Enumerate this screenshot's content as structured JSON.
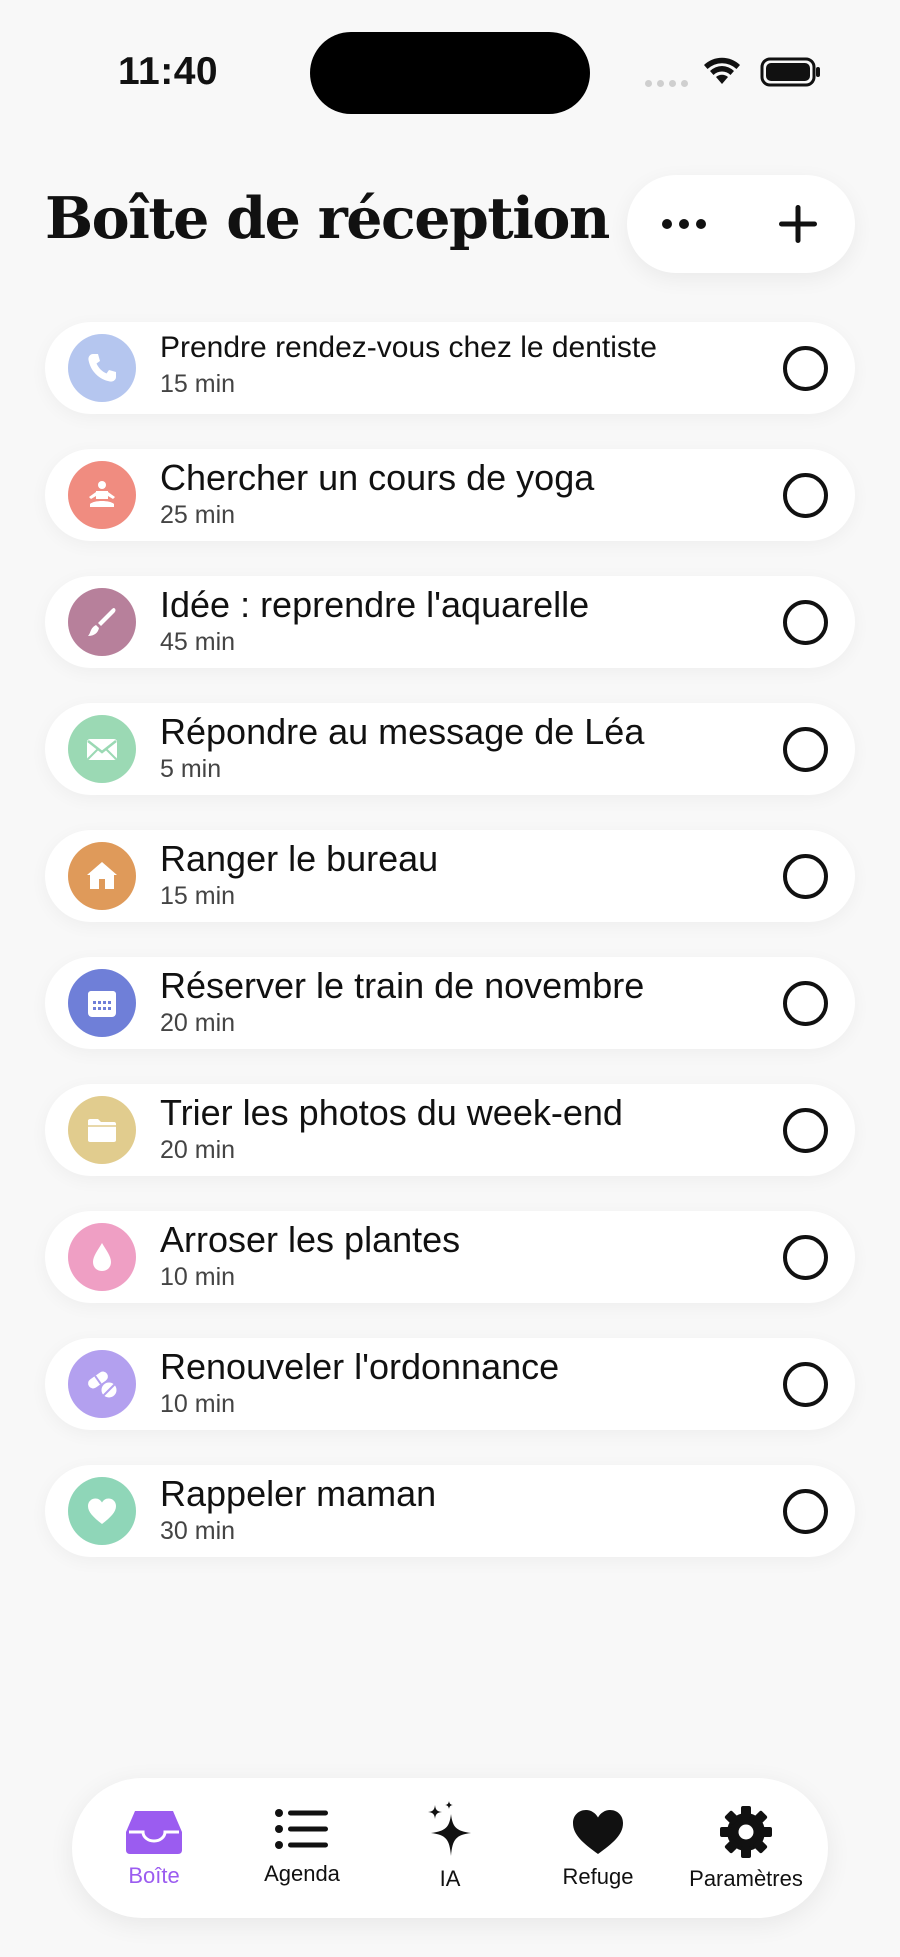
{
  "status_bar": {
    "time": "11:40"
  },
  "header": {
    "title": "Boîte de réception"
  },
  "tasks": [
    {
      "title": "Prendre rendez-vous chez le dentiste",
      "duration": "15 min",
      "icon": "phone-icon",
      "color": "#b5c6ef"
    },
    {
      "title": "Chercher un cours de yoga",
      "duration": "25 min",
      "icon": "meditation-icon",
      "color": "#f08c80"
    },
    {
      "title": "Idée : reprendre l'aquarelle",
      "duration": "45 min",
      "icon": "paintbrush-icon",
      "color": "#b7809b"
    },
    {
      "title": "Répondre au message de Léa",
      "duration": "5 min",
      "icon": "envelope-icon",
      "color": "#9bd9b4"
    },
    {
      "title": "Ranger le bureau",
      "duration": "15 min",
      "icon": "house-icon",
      "color": "#df9a5a"
    },
    {
      "title": "Réserver le train de novembre",
      "duration": "20 min",
      "icon": "calendar-icon",
      "color": "#6f7fd8"
    },
    {
      "title": "Trier les photos du week-end",
      "duration": "20 min",
      "icon": "folder-icon",
      "color": "#e1cc8e"
    },
    {
      "title": "Arroser les plantes",
      "duration": "10 min",
      "icon": "drop-icon",
      "color": "#ef9fc4"
    },
    {
      "title": "Renouveler l'ordonnance",
      "duration": "10 min",
      "icon": "pills-icon",
      "color": "#b3a0ef"
    },
    {
      "title": "Rappeler maman",
      "duration": "30 min",
      "icon": "heart-icon",
      "color": "#8fd6b8"
    }
  ],
  "tab_bar": {
    "active_color": "#9b5cf0",
    "tabs": [
      {
        "label": "Boîte",
        "icon": "inbox-tray-icon",
        "active": true
      },
      {
        "label": "Agenda",
        "icon": "list-icon",
        "active": false
      },
      {
        "label": "IA",
        "icon": "sparkles-icon",
        "active": false
      },
      {
        "label": "Refuge",
        "icon": "heart-icon",
        "active": false
      },
      {
        "label": "Paramètres",
        "icon": "gear-icon",
        "active": false
      }
    ]
  }
}
